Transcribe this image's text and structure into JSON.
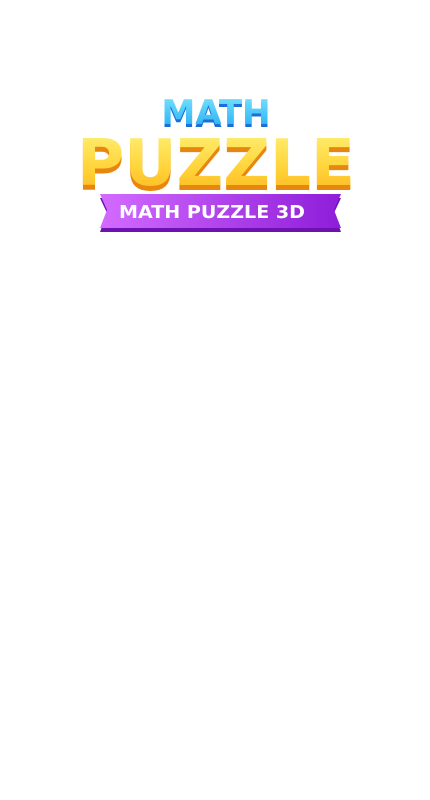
{
  "logo": {
    "top_word": "MATH",
    "main_word": "PUZZLE",
    "ribbon_text": "MATH PUZZLE 3D"
  },
  "colors": {
    "top_word_fill_top": "#7fe6ff",
    "top_word_fill_bottom": "#1aa9f2",
    "top_word_shadow": "#1c6fd6",
    "main_word_fill_top": "#fff27a",
    "main_word_fill_bottom": "#ffb21a",
    "main_word_shadow": "#e8870f",
    "ribbon_fill_left": "#d36bff",
    "ribbon_fill_right": "#8e1dd9",
    "ribbon_shadow": "#6d12b0",
    "ribbon_text": "#ffffff",
    "background": "#ffffff"
  }
}
